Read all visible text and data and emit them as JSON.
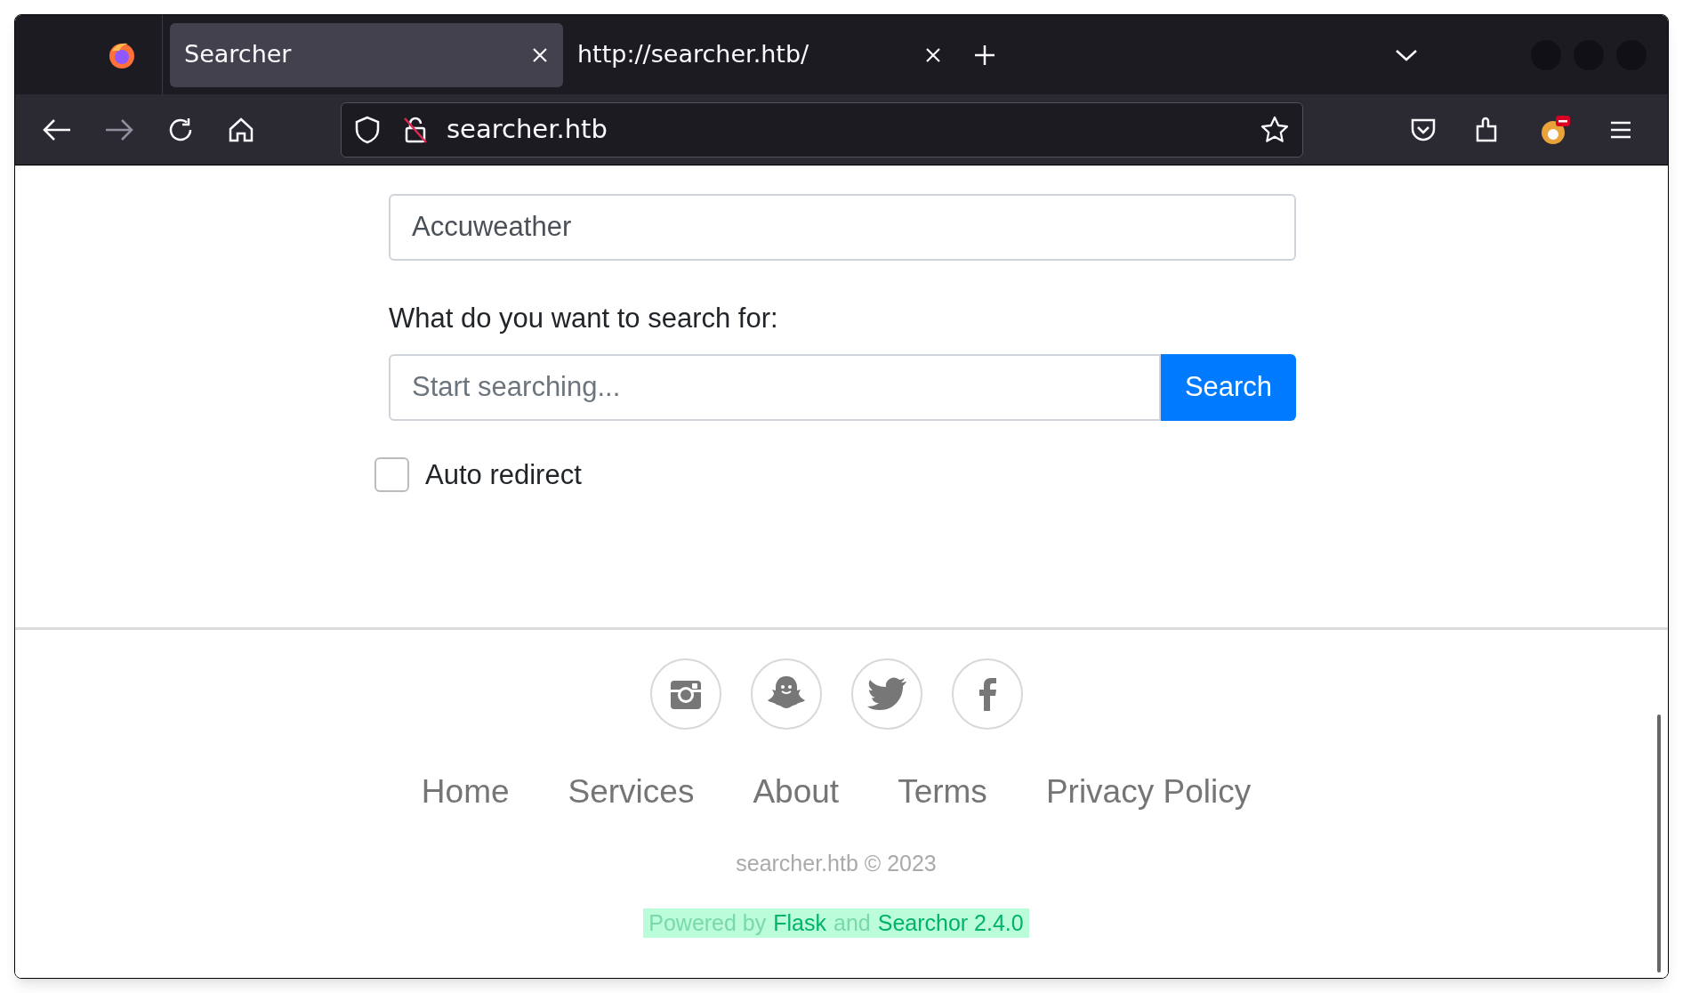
{
  "browser": {
    "tabs": [
      {
        "label": "Searcher",
        "selected": true
      },
      {
        "label": "http://searcher.htb/",
        "selected": false
      }
    ],
    "address": "searcher.htb"
  },
  "form": {
    "engine_value": "Accuweather",
    "query_label": "What do you want to search for:",
    "query_placeholder": "Start searching...",
    "search_button": "Search",
    "auto_redirect": {
      "label": "Auto redirect",
      "checked": false
    }
  },
  "footer": {
    "social": [
      {
        "kind": "instagram"
      },
      {
        "kind": "ghost"
      },
      {
        "kind": "bird"
      },
      {
        "kind": "facebook"
      }
    ],
    "links": [
      "Home",
      "Services",
      "About",
      "Terms",
      "Privacy Policy"
    ],
    "copyright": "searcher.htb © 2023",
    "powered": [
      {
        "kind": "text",
        "text": "Powered by"
      },
      {
        "kind": "link",
        "text": "Flask"
      },
      {
        "kind": "text",
        "text": "and"
      },
      {
        "kind": "link",
        "text": "Searchor 2.4.0"
      }
    ]
  }
}
